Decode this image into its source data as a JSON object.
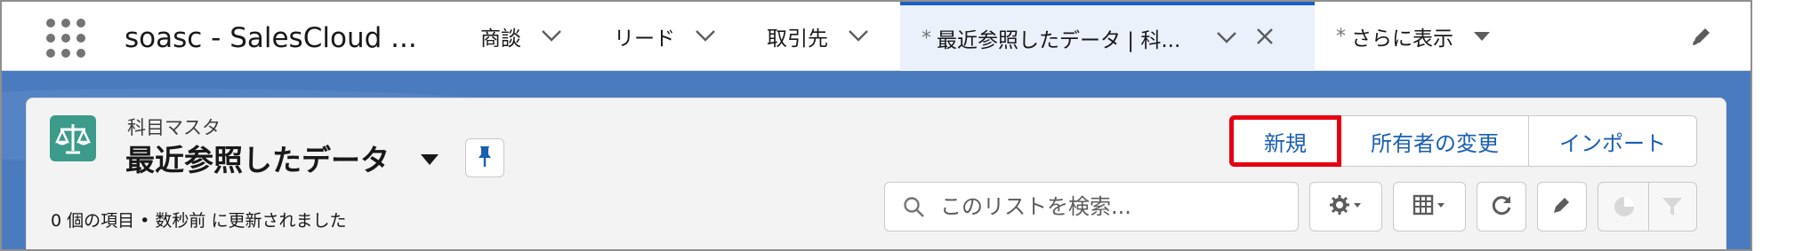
{
  "nav": {
    "app_name": "soasc - SalesCloud ...",
    "items": [
      {
        "label": "商談"
      },
      {
        "label": "リード"
      },
      {
        "label": "取引先"
      }
    ],
    "active_tab": {
      "dirty_mark": "*",
      "label": "最近参照したデータ | 科..."
    },
    "more": {
      "dirty_mark": "*",
      "label": "さらに表示"
    },
    "icons": [
      "app-launcher-icon",
      "chevron-down-icon",
      "close-icon",
      "caret-down-icon",
      "pencil-icon"
    ]
  },
  "list_header": {
    "object_label": "科目マスタ",
    "title": "最近参照したデータ",
    "status": "0 個の項目 • 数秒前 に更新されました",
    "object_icon": "scales-icon",
    "pin_icon": "pin-icon"
  },
  "actions": {
    "new_label": "新規",
    "change_owner_label": "所有者の変更",
    "import_label": "インポート"
  },
  "search": {
    "placeholder": "このリストを検索..."
  },
  "tools": [
    "gear-icon",
    "table-icon",
    "refresh-icon",
    "pencil-icon",
    "chart-icon",
    "filter-icon"
  ],
  "colors": {
    "brand_band": "#4b7bbf",
    "active_tab_bg": "#eaf1fb",
    "active_tab_border": "#1b5fc1",
    "object_icon_bg": "#3c9b8a",
    "link_blue": "#1a5fb4",
    "highlight_red": "#e60012"
  }
}
